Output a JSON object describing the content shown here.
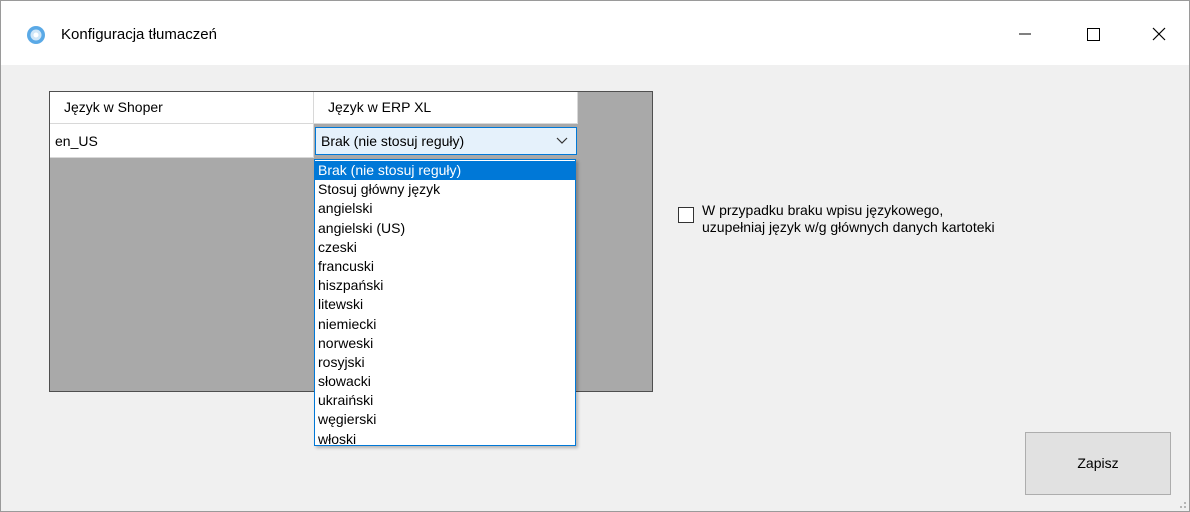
{
  "window": {
    "title": "Konfiguracja tłumaczeń",
    "controls": {
      "minimize": "minimize-icon",
      "maximize": "maximize-icon",
      "close": "close-icon"
    }
  },
  "grid": {
    "columns": [
      "Język w Shoper",
      "Język w ERP XL"
    ],
    "rows": [
      {
        "shoper": "en_US",
        "erp": "Brak (nie stosuj reguły)"
      }
    ]
  },
  "dropdown": {
    "selected": "Brak (nie stosuj reguły)",
    "options": [
      "Brak (nie stosuj reguły)",
      "Stosuj główny język",
      "angielski",
      "angielski (US)",
      "czeski",
      "francuski",
      "hiszpański",
      "litewski",
      "niemiecki",
      "norweski",
      "rosyjski",
      "słowacki",
      "ukraiński",
      "węgierski",
      "włoski"
    ]
  },
  "fallback_option": {
    "checked": false,
    "label_line1": "W przypadku braku wpisu językowego,",
    "label_line2": "uzupełniaj język w/g głównych danych kartoteki"
  },
  "buttons": {
    "save": "Zapisz"
  },
  "colors": {
    "accent": "#0078d7",
    "grid_background": "#a9a9a9",
    "window_background": "#f0f0f0"
  }
}
